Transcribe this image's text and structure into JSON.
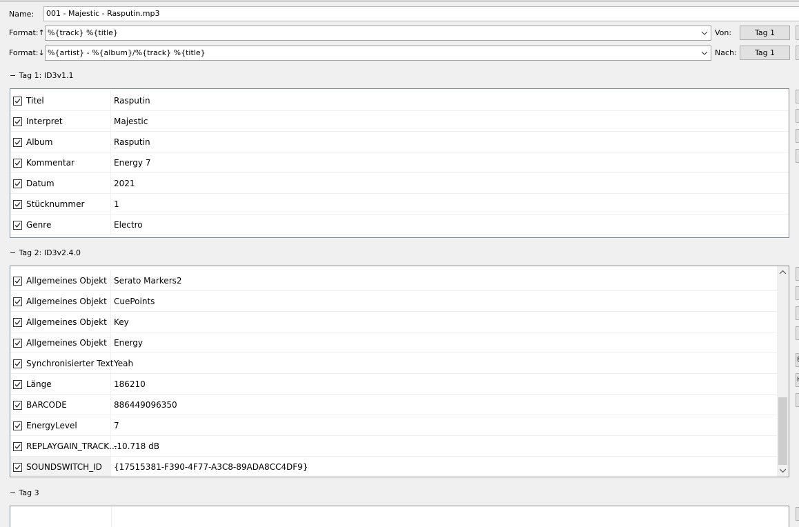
{
  "header": {
    "name_label": "Name:",
    "name_value": "001 - Majestic - Rasputin.mp3",
    "format_up_label": "Format:↑",
    "format_up_value": "%{track} %{title}",
    "format_down_label": "Format:↓",
    "format_down_value": "%{artist} - %{album}/%{track} %{title}",
    "von_label": "Von:",
    "von_button": "Tag 1",
    "nach_label": "Nach:",
    "nach_button": "Tag 1"
  },
  "tag1": {
    "title": "Tag 1: ID3v1.1",
    "collapse": "−",
    "rows": [
      {
        "name": "Titel",
        "value": "Rasputin",
        "checked": true
      },
      {
        "name": "Interpret",
        "value": "Majestic",
        "checked": true
      },
      {
        "name": "Album",
        "value": "Rasputin",
        "checked": true
      },
      {
        "name": "Kommentar",
        "value": "Energy 7",
        "checked": true
      },
      {
        "name": "Datum",
        "value": "2021",
        "checked": true
      },
      {
        "name": "Stücknummer",
        "value": "1",
        "checked": true
      },
      {
        "name": "Genre",
        "value": "Electro",
        "checked": true
      }
    ]
  },
  "tag2": {
    "title": "Tag 2: ID3v2.4.0",
    "collapse": "−",
    "rows": [
      {
        "name": "Allgemeines Objekt",
        "value": "Serato Markers2",
        "checked": true
      },
      {
        "name": "Allgemeines Objekt",
        "value": "CuePoints",
        "checked": true
      },
      {
        "name": "Allgemeines Objekt",
        "value": "Key",
        "checked": true
      },
      {
        "name": "Allgemeines Objekt",
        "value": "Energy",
        "checked": true
      },
      {
        "name": "Synchronisierter Text",
        "value": "Yeah",
        "checked": true
      },
      {
        "name": "Länge",
        "value": "186210",
        "checked": true
      },
      {
        "name": "BARCODE",
        "value": "886449096350",
        "checked": true
      },
      {
        "name": "EnergyLevel",
        "value": "7",
        "checked": true
      },
      {
        "name": "REPLAYGAIN_TRACK...",
        "value": "-10.718 dB",
        "checked": true
      },
      {
        "name": "SOUNDSWITCH_ID",
        "value": "{17515381-F390-4F77-A3C8-89ADA8CC4DF9}",
        "checked": true
      }
    ]
  },
  "tag3": {
    "title": "Tag 3",
    "collapse": "−"
  },
  "side_buttons": {
    "b_label": "E",
    "h_label": "H"
  },
  "icons": [
    "checkbox-checked-icon",
    "chevron-down-icon",
    "scroll-up-icon",
    "scroll-down-icon"
  ]
}
